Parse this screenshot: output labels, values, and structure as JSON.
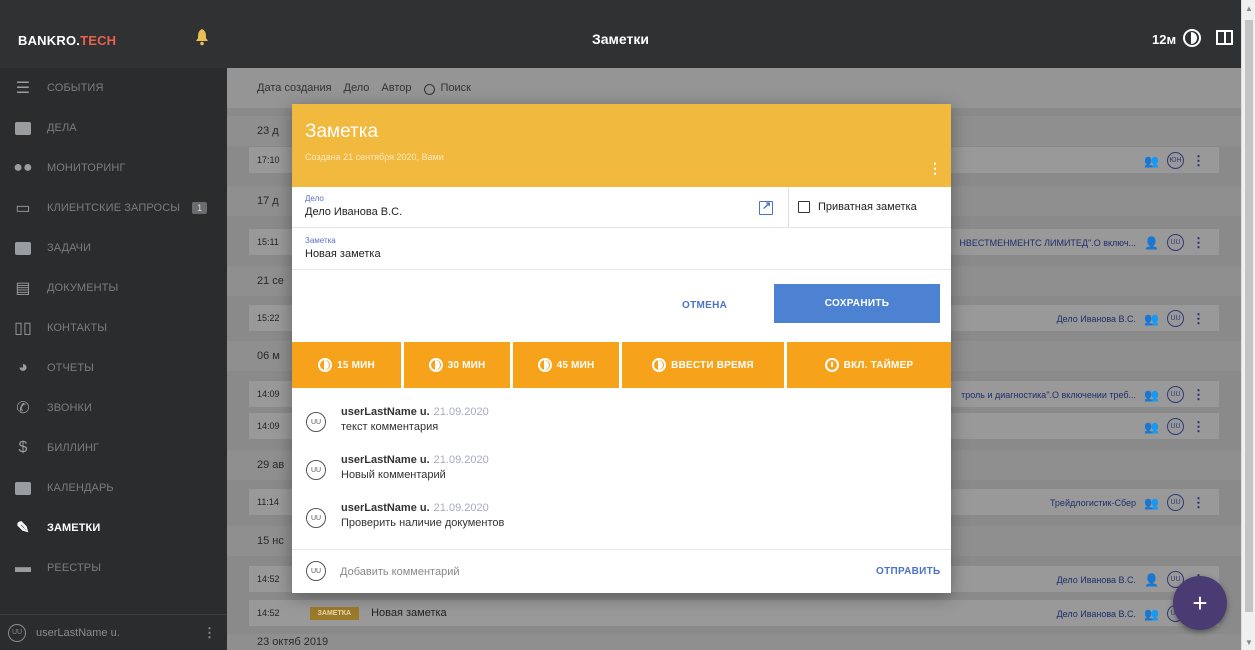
{
  "app": {
    "brand_main": "BANKRO.",
    "brand_tail": "TECH",
    "title": "Заметки",
    "timer": "12м"
  },
  "sidebar": {
    "items": [
      {
        "label": "События",
        "icon": "events-icon"
      },
      {
        "label": "Дела",
        "icon": "briefcase-icon"
      },
      {
        "label": "Мониторинг",
        "icon": "binoculars-icon"
      },
      {
        "label": "Клиентские запросы",
        "icon": "monitor-icon",
        "badge": "1"
      },
      {
        "label": "Задачи",
        "icon": "task-icon"
      },
      {
        "label": "Документы",
        "icon": "document-icon"
      },
      {
        "label": "Контакты",
        "icon": "book-icon"
      },
      {
        "label": "Отчеты",
        "icon": "pie-chart-icon"
      },
      {
        "label": "Звонки",
        "icon": "phone-icon"
      },
      {
        "label": "Биллинг",
        "icon": "dollar-icon"
      },
      {
        "label": "Календарь",
        "icon": "calendar-icon"
      },
      {
        "label": "Заметки",
        "icon": "pencil-icon",
        "active": true
      },
      {
        "label": "Реестры",
        "icon": "registry-icon"
      }
    ],
    "user": {
      "initials": "UU",
      "name": "userLastName u."
    }
  },
  "filters": {
    "created": "Дата создания",
    "case": "Дело",
    "author": "Автор",
    "search": "Поиск"
  },
  "list": {
    "groups": [
      "23 д",
      "17 д",
      "21 се",
      "06 м",
      "29 ав",
      "15 нс",
      "23 октяб 2019"
    ],
    "rows": [
      {
        "time": "17:10",
        "right": "",
        "initials": "ЮН"
      },
      {
        "time": "15:11",
        "right": "НВЕСТМЕНМЕНТС ЛИМИТЕД\".О включ...",
        "initials": "UU"
      },
      {
        "time": "15:22",
        "right": "Дело Иванова В.С.",
        "initials": "UU"
      },
      {
        "time": "14:09",
        "right": "троль и диагностика\".О включении треб...",
        "initials": "UU"
      },
      {
        "time": "14:09",
        "right": "",
        "initials": "UU"
      },
      {
        "time": "11:14",
        "right": "Трейдлогистик-Сбер",
        "initials": "UU"
      },
      {
        "time": "14:52",
        "right": "Дело Иванова В.С.",
        "initials": "UU"
      },
      {
        "time": "14:52",
        "tag": "ЗАМЕТКА",
        "title": "Новая заметка",
        "right": "Дело Иванова В.С.",
        "initials": "UU"
      }
    ]
  },
  "modal": {
    "title": "Заметка",
    "subtitle": "Создана 21 сентября 2020, Вами",
    "case_label": "Дело",
    "case_value": "Дело Иванова В.С.",
    "private_label": "Приватная заметка",
    "note_label": "Заметка",
    "note_value": "Новая заметка",
    "cancel": "ОТМЕНА",
    "save": "СОХРАНИТЬ",
    "time_buttons": [
      "15 МИН",
      "30 МИН",
      "45 МИН",
      "ВВЕСТИ ВРЕМЯ",
      "ВКЛ. ТАЙМЕР"
    ],
    "comments": [
      {
        "initials": "UU",
        "author": "userLastName u.",
        "date": "21.09.2020",
        "text": "текст комментария"
      },
      {
        "initials": "UU",
        "author": "userLastName u.",
        "date": "21.09.2020",
        "text": "Новый комментарий"
      },
      {
        "initials": "UU",
        "author": "userLastName u.",
        "date": "21.09.2020",
        "text": "Проверить наличие документов"
      }
    ],
    "add_comment_placeholder": "Добавить комментарий",
    "send": "ОТПРАВИТЬ",
    "footer_initials": "UU"
  },
  "colors": {
    "header": "#f2b93f",
    "timebar": "#f7a21b",
    "primary": "#4c82d1",
    "sidebar": "#2a2c2e"
  }
}
